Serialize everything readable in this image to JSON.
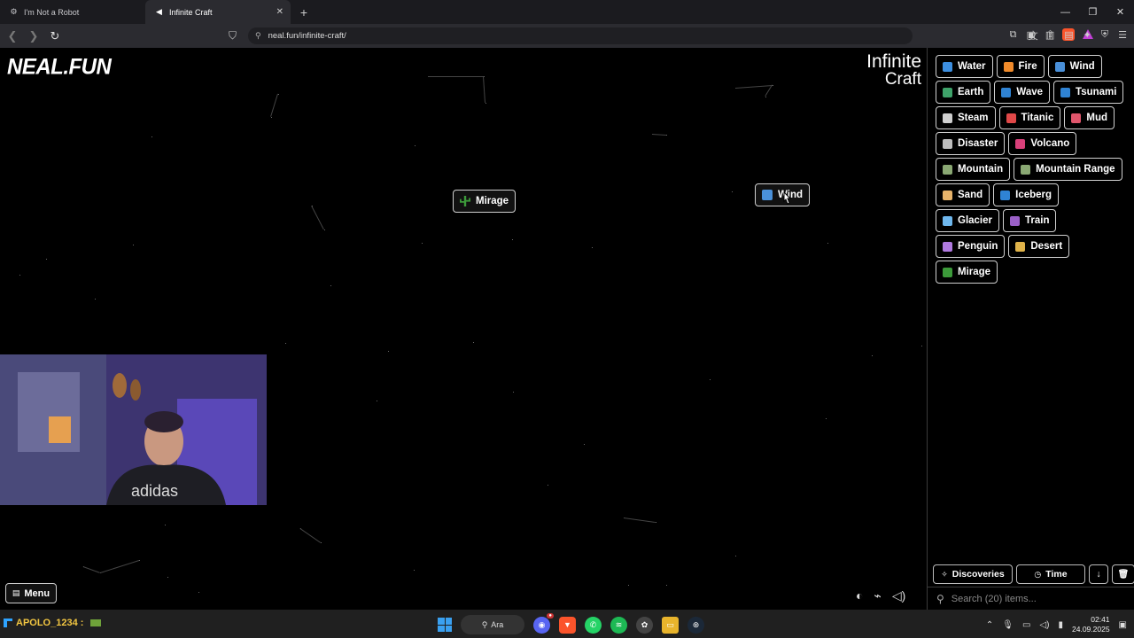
{
  "browser": {
    "tabs": [
      {
        "label": "I'm Not a Robot",
        "active": false
      },
      {
        "label": "Infinite Craft",
        "active": true
      }
    ],
    "url": "neal.fun/infinite-craft/"
  },
  "page": {
    "logo": "NEAL.FUN",
    "title_line1": "Infinite",
    "title_line2": "Craft",
    "menu_label": "Menu",
    "canvas_elements": [
      {
        "label": "Mirage",
        "icon": "cactus-icon",
        "color": "#3c9a3a"
      },
      {
        "label": "Wind",
        "icon": "wind-icon",
        "color": "#4a90d9"
      }
    ]
  },
  "sidebar": {
    "items": [
      {
        "label": "Water",
        "icon": "water-drop-icon",
        "color": "#3d8fe0"
      },
      {
        "label": "Fire",
        "icon": "fire-icon",
        "color": "#f08a2a"
      },
      {
        "label": "Wind",
        "icon": "wind-icon",
        "color": "#4a90d9"
      },
      {
        "label": "Earth",
        "icon": "globe-icon",
        "color": "#3fa36a"
      },
      {
        "label": "Wave",
        "icon": "wave-icon",
        "color": "#2f83d4"
      },
      {
        "label": "Tsunami",
        "icon": "wave-icon",
        "color": "#2f83d4"
      },
      {
        "label": "Steam",
        "icon": "steam-icon",
        "color": "#cfcfcf"
      },
      {
        "label": "Titanic",
        "icon": "ship-icon",
        "color": "#e04848"
      },
      {
        "label": "Mud",
        "icon": "mud-icon",
        "color": "#e0566c"
      },
      {
        "label": "Disaster",
        "icon": "tornado-icon",
        "color": "#bdbdbd"
      },
      {
        "label": "Volcano",
        "icon": "volcano-icon",
        "color": "#d9407a"
      },
      {
        "label": "Mountain",
        "icon": "mountain-icon",
        "color": "#8aa873"
      },
      {
        "label": "Mountain Range",
        "icon": "mountain-icon",
        "color": "#8aa873"
      },
      {
        "label": "Sand",
        "icon": "sand-icon",
        "color": "#e7b36a"
      },
      {
        "label": "Iceberg",
        "icon": "wave-icon",
        "color": "#2f83d4"
      },
      {
        "label": "Glacier",
        "icon": "snowflake-icon",
        "color": "#6fb8ee"
      },
      {
        "label": "Train",
        "icon": "train-icon",
        "color": "#9a5fc7"
      },
      {
        "label": "Penguin",
        "icon": "penguin-icon",
        "color": "#b07ae0"
      },
      {
        "label": "Desert",
        "icon": "desert-icon",
        "color": "#e0b34a"
      },
      {
        "label": "Mirage",
        "icon": "cactus-icon",
        "color": "#3c9a3a"
      }
    ],
    "discoveries_label": "Discoveries",
    "time_label": "Time",
    "sort_label": "↓",
    "search_placeholder": "Search (20) items..."
  },
  "taskbar": {
    "user": "APOLO_1234 :",
    "search_label": "Ara",
    "time": "02:41",
    "date": "24.09.2025"
  },
  "colors": {
    "tray_badge": "#cc3333",
    "windows_blue": "#3aa0f0",
    "brave_orange": "#fb542b"
  }
}
